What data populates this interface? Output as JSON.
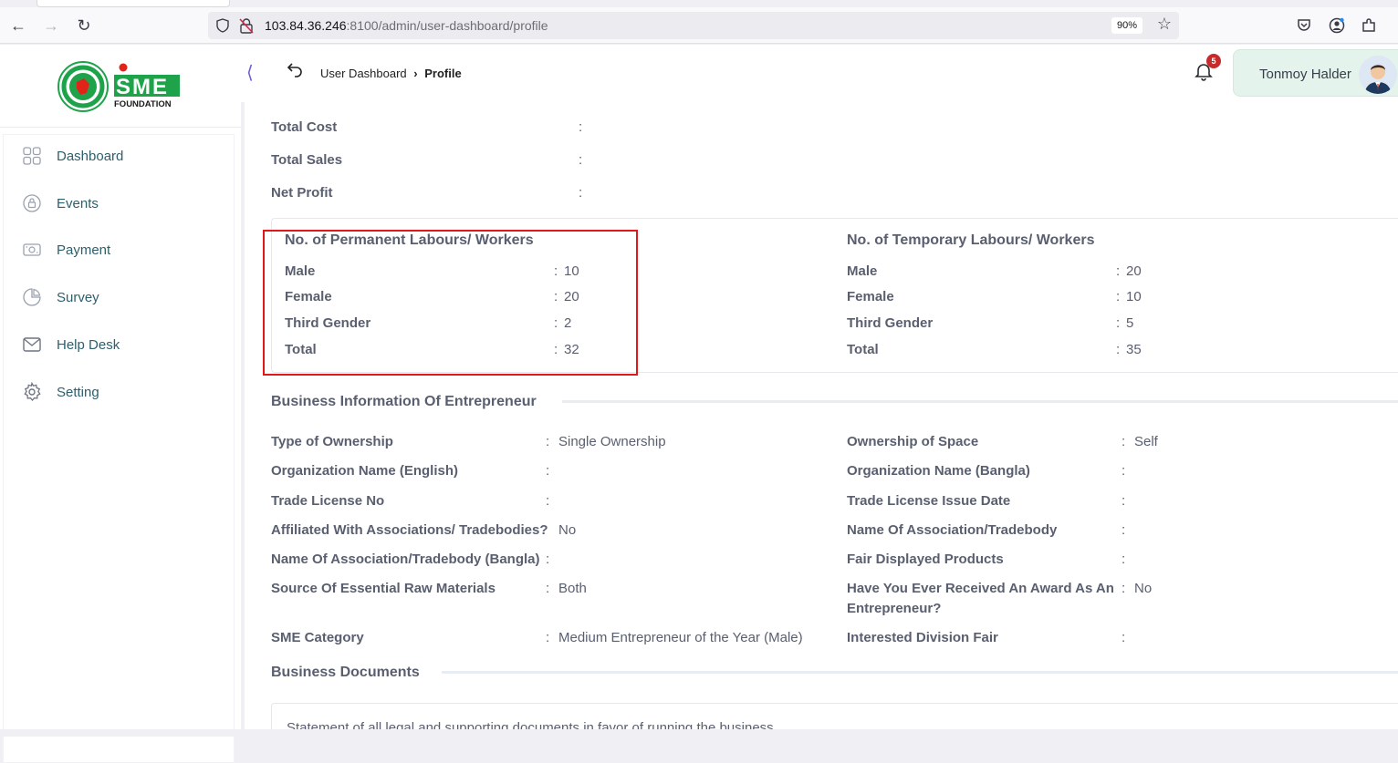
{
  "browser": {
    "url_host": "103.84.36.246",
    "url_rest": ":8100/admin/user-dashboard/profile",
    "zoom": "90%"
  },
  "logo": {
    "brand_text": "SME",
    "brand_sub": "FOUNDATION",
    "colors": {
      "green": "#1fa34a",
      "red": "#e2231a"
    }
  },
  "sidebar": {
    "items": [
      {
        "label": "Dashboard",
        "icon": "grid-icon"
      },
      {
        "label": "Events",
        "icon": "calendar-lock-icon"
      },
      {
        "label": "Payment",
        "icon": "money-icon"
      },
      {
        "label": "Survey",
        "icon": "pie-chart-icon"
      },
      {
        "label": "Help Desk",
        "icon": "mail-icon"
      },
      {
        "label": "Setting",
        "icon": "gear-icon"
      }
    ]
  },
  "header": {
    "crumb_parent": "User Dashboard",
    "crumb_current": "Profile",
    "notification_count": "5",
    "user_name": "Tonmoy Halder"
  },
  "financials": [
    {
      "label": "Total Cost",
      "value": ""
    },
    {
      "label": "Total Sales",
      "value": ""
    },
    {
      "label": "Net Profit",
      "value": ""
    }
  ],
  "permanent": {
    "title": "No. of Permanent Labours/ Workers",
    "rows": [
      {
        "label": "Male",
        "value": "10"
      },
      {
        "label": "Female",
        "value": "20"
      },
      {
        "label": "Third Gender",
        "value": "2"
      },
      {
        "label": "Total",
        "value": "32"
      }
    ]
  },
  "temporary": {
    "title": "No. of Temporary Labours/ Workers",
    "rows": [
      {
        "label": "Male",
        "value": "20"
      },
      {
        "label": "Female",
        "value": "10"
      },
      {
        "label": "Third Gender",
        "value": "5"
      },
      {
        "label": "Total",
        "value": "35"
      }
    ]
  },
  "business": {
    "title": "Business Information Of Entrepreneur",
    "left": [
      {
        "label": "Type of Ownership",
        "value": "Single Ownership"
      },
      {
        "label": "Organization Name (English)",
        "value": ""
      },
      {
        "label": "Trade License No",
        "value": ""
      },
      {
        "label": "Affiliated With Associations/ Tradebodies?",
        "value": "No"
      },
      {
        "label": "Name Of Association/Tradebody (Bangla)",
        "value": ""
      },
      {
        "label": "Source Of Essential Raw Materials",
        "value": "Both"
      },
      {
        "label": "SME Category",
        "value": "Medium Entrepreneur of the Year (Male)"
      }
    ],
    "right": [
      {
        "label": "Ownership of Space",
        "value": "Self"
      },
      {
        "label": "Organization Name (Bangla)",
        "value": ""
      },
      {
        "label": "Trade License Issue Date",
        "value": ""
      },
      {
        "label": "Name Of Association/Tradebody",
        "value": ""
      },
      {
        "label": "Fair Displayed Products",
        "value": ""
      },
      {
        "label": "Have You Ever Received An Award As An",
        "label2": "Entrepreneur?",
        "value": "No"
      },
      {
        "label": "Interested Division Fair",
        "value": ""
      }
    ]
  },
  "documents": {
    "title": "Business Documents",
    "first_line": "Statement of all legal and supporting documents in favor of running the business"
  },
  "colon": ":"
}
